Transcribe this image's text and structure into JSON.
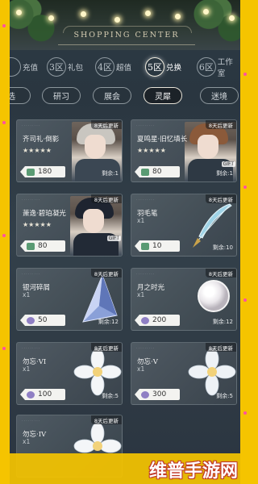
{
  "banner": {
    "title": "SHOPPING CENTER"
  },
  "num_tabs": [
    {
      "num": "",
      "label": "充值"
    },
    {
      "num": "3区",
      "label": "礼包"
    },
    {
      "num": "4区",
      "label": "超值"
    },
    {
      "num": "5区",
      "label": "兑换"
    },
    {
      "num": "6区",
      "label": "工作室"
    }
  ],
  "cat_tabs": [
    "选",
    "研习",
    "展会",
    "灵犀",
    "迷境"
  ],
  "active_cat": "灵犀",
  "cards": [
    {
      "name": "齐司礼·倒影",
      "stars": "★★★★★",
      "price": "180",
      "currency": "green",
      "timer": "8天后更新",
      "remain": "剩余:1",
      "gift": ""
    },
    {
      "name": "夏鸣星·旧忆填长",
      "stars": "★★★★★",
      "price": "80",
      "currency": "green",
      "timer": "8天后更新",
      "remain": "剩余:1",
      "gift": "GIFT"
    },
    {
      "name": "萧逸·碧珀凝光",
      "stars": "★★★★★",
      "price": "80",
      "currency": "green",
      "timer": "8天后更新",
      "remain": "",
      "gift": "GIFT"
    },
    {
      "name": "羽毛笔",
      "qty": "x1",
      "price": "10",
      "currency": "green",
      "timer": "8天后更新",
      "remain": "剩余:10"
    },
    {
      "name": "银河碎屑",
      "qty": "x1",
      "price": "50",
      "currency": "purple",
      "timer": "8天后更新",
      "remain": "剩余:12"
    },
    {
      "name": "月之时光",
      "qty": "x1",
      "price": "200",
      "currency": "purple",
      "timer": "8天后更新",
      "remain": "剩余:12"
    },
    {
      "name": "勿忘·VI",
      "qty": "x1",
      "price": "100",
      "currency": "purple",
      "timer": "8天后更新",
      "remain": "剩余:5"
    },
    {
      "name": "勿忘·V",
      "qty": "x1",
      "price": "300",
      "currency": "purple",
      "timer": "8天后更新",
      "remain": "剩余:5"
    },
    {
      "name": "勿忘·IV",
      "qty": "x1",
      "price": "",
      "currency": "purple",
      "timer": "8天后更新",
      "remain": ""
    }
  ],
  "watermark": "维普手游网",
  "colors": {
    "frame": "#f5c400",
    "accent_green": "#5a9b73",
    "accent_purple": "#8f7fc4"
  }
}
